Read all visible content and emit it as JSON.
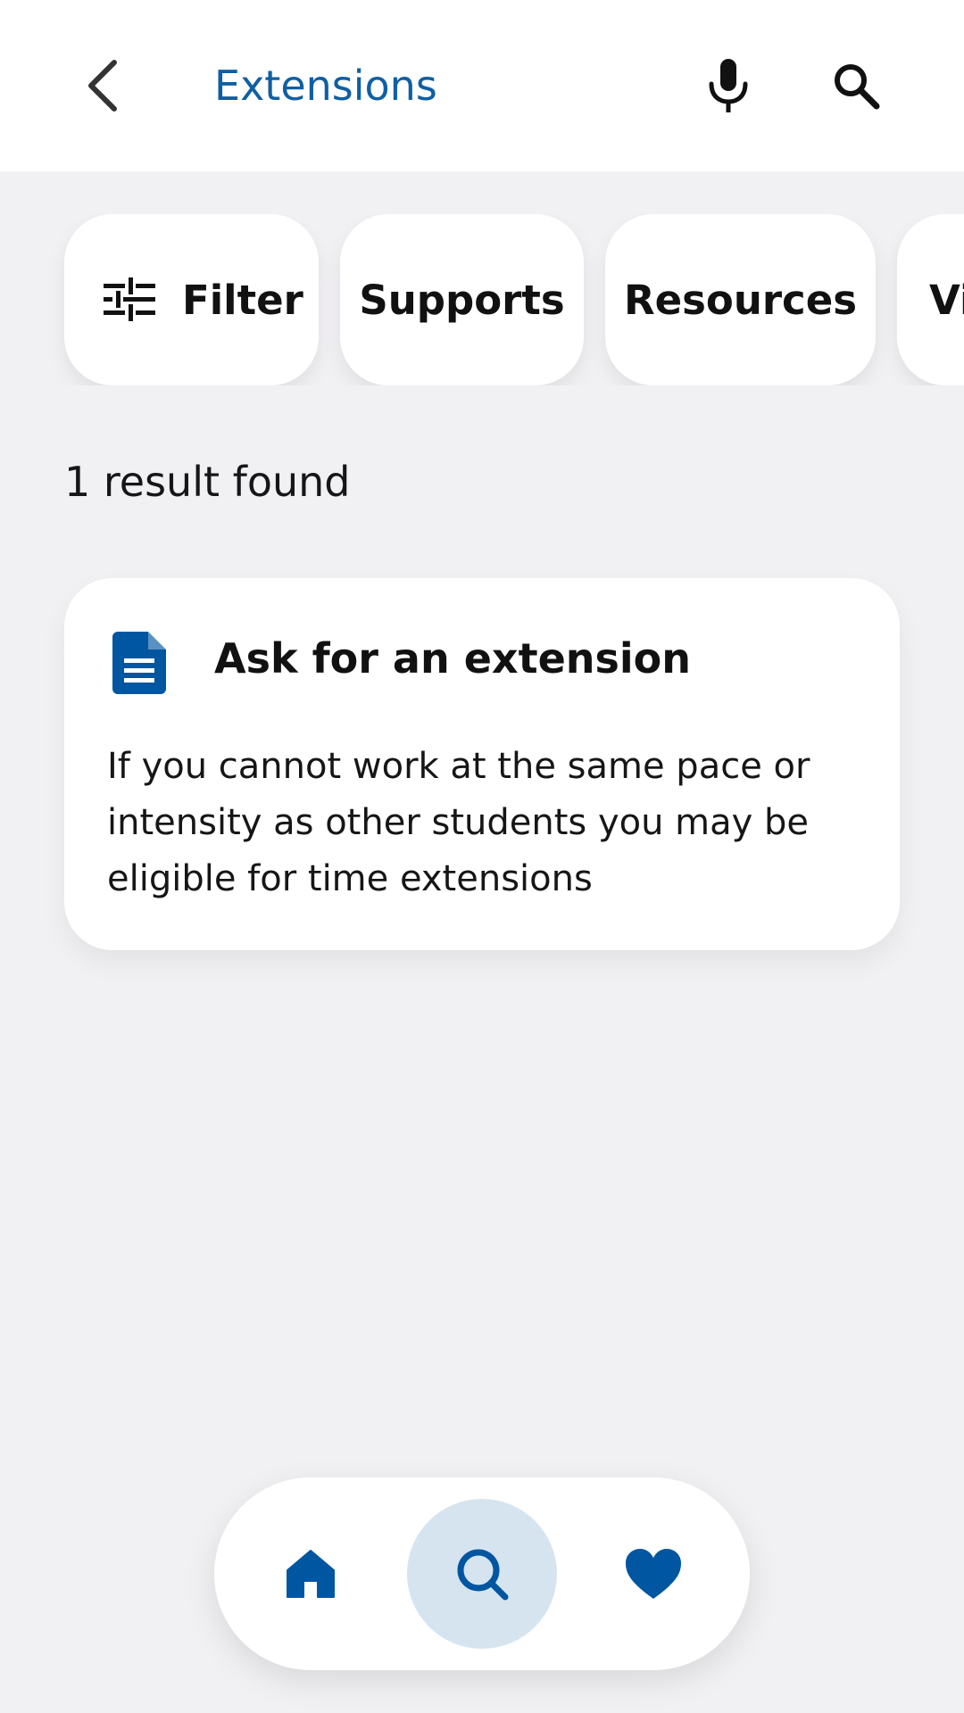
{
  "header": {
    "title": "Extensions",
    "back_icon": "chevron-left-icon",
    "mic_icon": "microphone-icon",
    "search_icon": "search-icon"
  },
  "filters": {
    "filter_label": "Filter",
    "filter_icon": "sliders-icon",
    "chips": [
      "Supports",
      "Resources",
      "Vi"
    ]
  },
  "results": {
    "count_text": "1 result found",
    "items": [
      {
        "icon": "document-icon",
        "title": "Ask for an extension",
        "description": "If you cannot work at the same pace or intensity as other students you may be eligible for time extensions"
      }
    ]
  },
  "bottom_nav": {
    "items": [
      {
        "icon": "home-icon",
        "active": false
      },
      {
        "icon": "search-icon",
        "active": true
      },
      {
        "icon": "heart-icon",
        "active": false
      }
    ]
  },
  "colors": {
    "accent": "#0f5fa3",
    "nav_icon": "#0056a1",
    "active_nav_bg": "#d6e4f0",
    "background": "#f1f0f3",
    "surface": "#ffffff"
  }
}
